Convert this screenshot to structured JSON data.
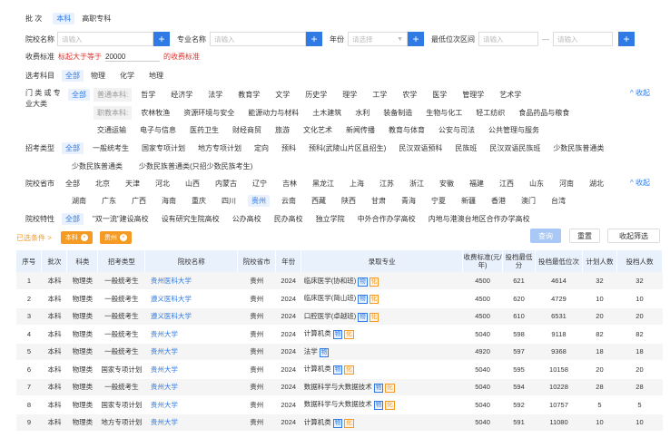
{
  "batch": {
    "label": "批 次",
    "options": [
      "本科",
      "高职专科"
    ]
  },
  "search": {
    "school_label": "院校名称",
    "school_placeholder": "请输入",
    "major_label": "专业名称",
    "major_placeholder": "请输入",
    "year_label": "年份",
    "year_placeholder": "请选择",
    "rank_label": "最低位次区间",
    "rank_from_placeholder": "请输入",
    "rank_dash": "—",
    "rank_to_placeholder": "请输入",
    "plus": "+"
  },
  "fee": {
    "label": "收费标准",
    "hint": "标起大于等于",
    "value": "20000",
    "unit": "的收费标准"
  },
  "subjects": {
    "label": "选考科目",
    "options": [
      "全部",
      "物理",
      "化学",
      "地理"
    ]
  },
  "categories": {
    "label": "门 类 或 专业大类",
    "all": "全部",
    "undergrad_label": "普通本科:",
    "undergrad": [
      "哲学",
      "经济学",
      "法学",
      "教育学",
      "文学",
      "历史学",
      "理学",
      "工学",
      "农学",
      "医学",
      "管理学",
      "艺术学"
    ],
    "vocational_label": "职教本科:",
    "vocational_row1": [
      "农林牧渔",
      "资源环境与安全",
      "能源动力与材料",
      "土木建筑",
      "水利",
      "装备制造",
      "生物与化工",
      "轻工纺织",
      "食品药品与粮食"
    ],
    "vocational_row2": [
      "交通运输",
      "电子与信息",
      "医药卫生",
      "财经商贸",
      "旅游",
      "文化艺术",
      "新闻传播",
      "教育与体育",
      "公安与司法",
      "公共管理与服务"
    ],
    "collapse": "收起"
  },
  "enroll_type": {
    "label": "招考类型",
    "row1": [
      "全部",
      "一般统考生",
      "国家专项计划",
      "地方专项计划",
      "定向",
      "预科",
      "预科(武陵山片区县招生)",
      "民汉双语预科",
      "民族班",
      "民汉双语民族班",
      "少数民族普通类"
    ],
    "row2": [
      "少数民族普通类",
      "少数民族普通类(只招少数民族考生)"
    ]
  },
  "province": {
    "label": "院校省市",
    "row1": [
      "全部",
      "北京",
      "天津",
      "河北",
      "山西",
      "内蒙古",
      "辽宁",
      "吉林",
      "黑龙江",
      "上海",
      "江苏",
      "浙江",
      "安徽",
      "福建",
      "江西",
      "山东",
      "河南",
      "湖北"
    ],
    "row2": [
      "湖南",
      "广东",
      "广西",
      "海南",
      "重庆",
      "四川",
      "贵州",
      "云南",
      "西藏",
      "陕西",
      "甘肃",
      "青海",
      "宁夏",
      "新疆",
      "香港",
      "澳门",
      "台湾"
    ],
    "selected": "贵州",
    "collapse": "收起"
  },
  "feature": {
    "label": "院校特性",
    "options": [
      "全部",
      "\"双一流\"建设高校",
      "设有研究生院高校",
      "公办高校",
      "民办高校",
      "独立学院",
      "中外合作办学高校",
      "内地与港澳台地区合作办学高校"
    ]
  },
  "selected_filters": {
    "label": "已选条件 >",
    "chips": [
      "本科",
      "贵州"
    ]
  },
  "actions": {
    "query": "查询",
    "reset": "重置",
    "collapse_filter": "收起筛选"
  },
  "table": {
    "headers": [
      "序号",
      "批次",
      "科类",
      "招考类型",
      "院校名称",
      "院校省市",
      "年份",
      "录取专业",
      "收费标准(元/年)",
      "投档最低分",
      "投档最低位次",
      "计划人数",
      "投档人数"
    ],
    "rows": [
      {
        "no": "1",
        "batch": "本科",
        "cat": "物理类",
        "type": "一般统考生",
        "school": "贵州医科大学",
        "prov": "贵州",
        "year": "2024",
        "major": "临床医学(协和班)",
        "tags": [
          "物",
          "化"
        ],
        "fee": "4500",
        "score": "621",
        "rank": "4614",
        "plan": "32",
        "admit": "32"
      },
      {
        "no": "2",
        "batch": "本科",
        "cat": "物理类",
        "type": "一般统考生",
        "school": "遵义医科大学",
        "prov": "贵州",
        "year": "2024",
        "major": "临床医学(简山班)",
        "tags": [
          "物",
          "化"
        ],
        "fee": "4500",
        "score": "620",
        "rank": "4729",
        "plan": "10",
        "admit": "10"
      },
      {
        "no": "3",
        "batch": "本科",
        "cat": "物理类",
        "type": "一般统考生",
        "school": "遵义医科大学",
        "prov": "贵州",
        "year": "2024",
        "major": "口腔医学(卓越班)",
        "tags": [
          "物",
          "化"
        ],
        "fee": "4500",
        "score": "610",
        "rank": "6531",
        "plan": "20",
        "admit": "20"
      },
      {
        "no": "4",
        "batch": "本科",
        "cat": "物理类",
        "type": "一般统考生",
        "school": "贵州大学",
        "prov": "贵州",
        "year": "2024",
        "major": "计算机类",
        "tags": [
          "物",
          "化"
        ],
        "fee": "5040",
        "score": "598",
        "rank": "9118",
        "plan": "82",
        "admit": "82"
      },
      {
        "no": "5",
        "batch": "本科",
        "cat": "物理类",
        "type": "一般统考生",
        "school": "贵州大学",
        "prov": "贵州",
        "year": "2024",
        "major": "法学",
        "tags": [
          "物"
        ],
        "fee": "4920",
        "score": "597",
        "rank": "9368",
        "plan": "18",
        "admit": "18"
      },
      {
        "no": "6",
        "batch": "本科",
        "cat": "物理类",
        "type": "国家专项计划",
        "school": "贵州大学",
        "prov": "贵州",
        "year": "2024",
        "major": "计算机类",
        "tags": [
          "物",
          "化"
        ],
        "fee": "5040",
        "score": "595",
        "rank": "10158",
        "plan": "20",
        "admit": "20"
      },
      {
        "no": "7",
        "batch": "本科",
        "cat": "物理类",
        "type": "一般统考生",
        "school": "贵州大学",
        "prov": "贵州",
        "year": "2024",
        "major": "数据科学与大数据技术",
        "tags": [
          "物",
          "化"
        ],
        "fee": "5040",
        "score": "594",
        "rank": "10228",
        "plan": "28",
        "admit": "28"
      },
      {
        "no": "8",
        "batch": "本科",
        "cat": "物理类",
        "type": "国家专项计划",
        "school": "贵州大学",
        "prov": "贵州",
        "year": "2024",
        "major": "数据科学与大数据技术",
        "tags": [
          "物",
          "化"
        ],
        "fee": "5040",
        "score": "592",
        "rank": "10757",
        "plan": "5",
        "admit": "5"
      },
      {
        "no": "9",
        "batch": "本科",
        "cat": "物理类",
        "type": "地方专项计划",
        "school": "贵州大学",
        "prov": "贵州",
        "year": "2024",
        "major": "计算机类",
        "tags": [
          "物",
          "化"
        ],
        "fee": "5040",
        "score": "591",
        "rank": "11080",
        "plan": "10",
        "admit": "10"
      }
    ]
  }
}
